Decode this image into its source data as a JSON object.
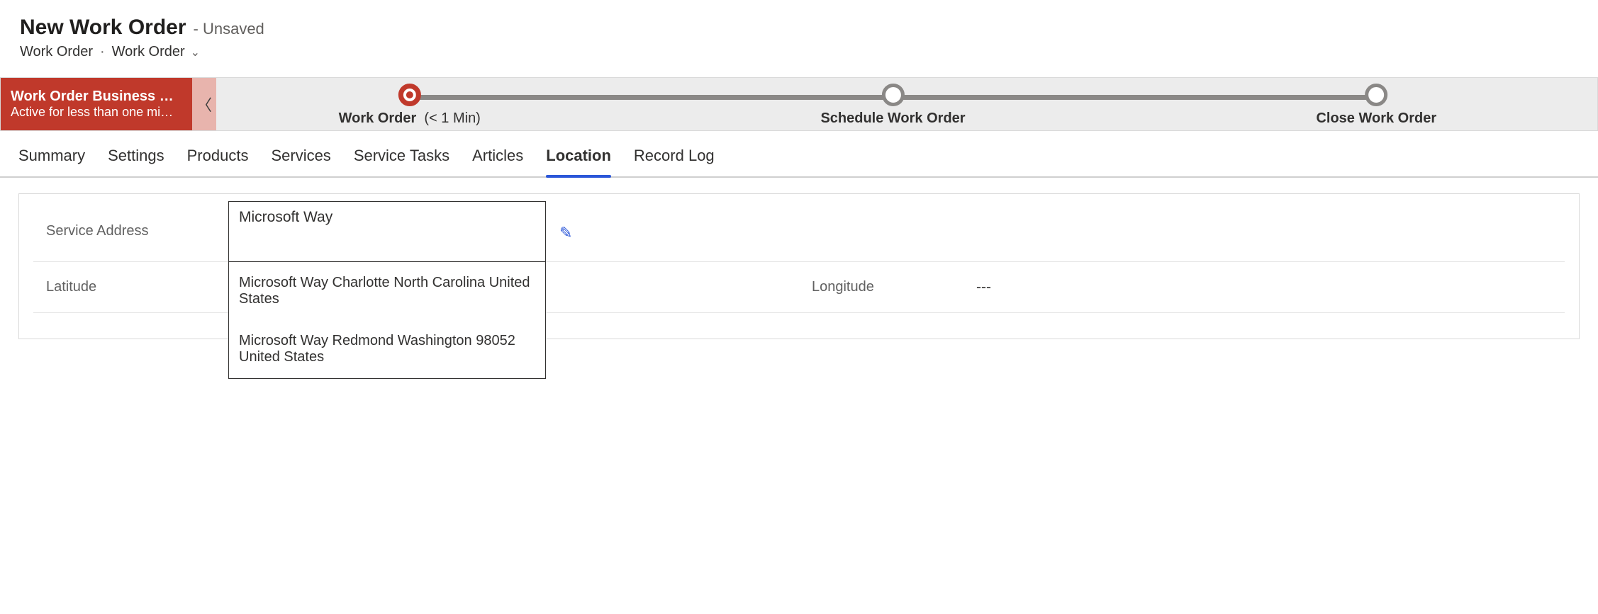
{
  "header": {
    "title": "New Work Order",
    "status": "- Unsaved",
    "breadcrumb1": "Work Order",
    "breadcrumb2": "Work Order"
  },
  "bpf": {
    "name": "Work Order Business Pro…",
    "duration": "Active for less than one mi…",
    "stages": [
      {
        "label": "Work Order",
        "dur": "(< 1 Min)",
        "active": true,
        "pos": 14
      },
      {
        "label": "Schedule Work Order",
        "dur": "",
        "active": false,
        "pos": 49
      },
      {
        "label": "Close Work Order",
        "dur": "",
        "active": false,
        "pos": 84
      }
    ]
  },
  "tabs": [
    "Summary",
    "Settings",
    "Products",
    "Services",
    "Service Tasks",
    "Articles",
    "Location",
    "Record Log"
  ],
  "active_tab": "Location",
  "form": {
    "service_address_label": "Service Address",
    "service_address_value": "Microsoft Way",
    "latitude_label": "Latitude",
    "latitude_value": "",
    "longitude_label": "Longitude",
    "longitude_value": "---",
    "suggestions": [
      "Microsoft Way Charlotte North Carolina United States",
      "Microsoft Way Redmond Washington 98052 United States"
    ]
  }
}
